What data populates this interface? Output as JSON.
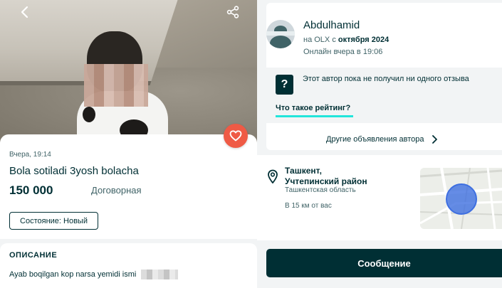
{
  "listing": {
    "posted": "Вчера, 19:14",
    "title": "Bola sotiladi 3yosh bolacha",
    "price": "150 000",
    "price_note": "Договорная",
    "condition": "Состояние: Новый",
    "description_heading": "ОПИСАНИЕ",
    "description": "Ayab boqilgan kop narsa yemidi ismi"
  },
  "seller": {
    "name": "Abdulhamid",
    "since_prefix": "на OLX с ",
    "since_date": "октября 2024",
    "online": "Онлайн вчера в 19:06",
    "no_reviews": "Этот автор пока не получил ни одного отзыва",
    "rating_link": "Что такое рейтинг?",
    "other_ads": "Другие объявления автора"
  },
  "location": {
    "city_line1": "Ташкент,",
    "city_line2": "Учтепинский район",
    "region": "Ташкентская область",
    "distance": "В 15 км от вас"
  },
  "actions": {
    "message": "Сообщение"
  },
  "colors": {
    "brand_dark": "#002f34",
    "favorite": "#ef5a45",
    "accent": "#23e5db",
    "map_marker": "#3e6fe0"
  },
  "icons": [
    "back-arrow-icon",
    "share-icon",
    "heart-icon",
    "question-icon",
    "chevron-right-icon",
    "location-pin-icon"
  ]
}
